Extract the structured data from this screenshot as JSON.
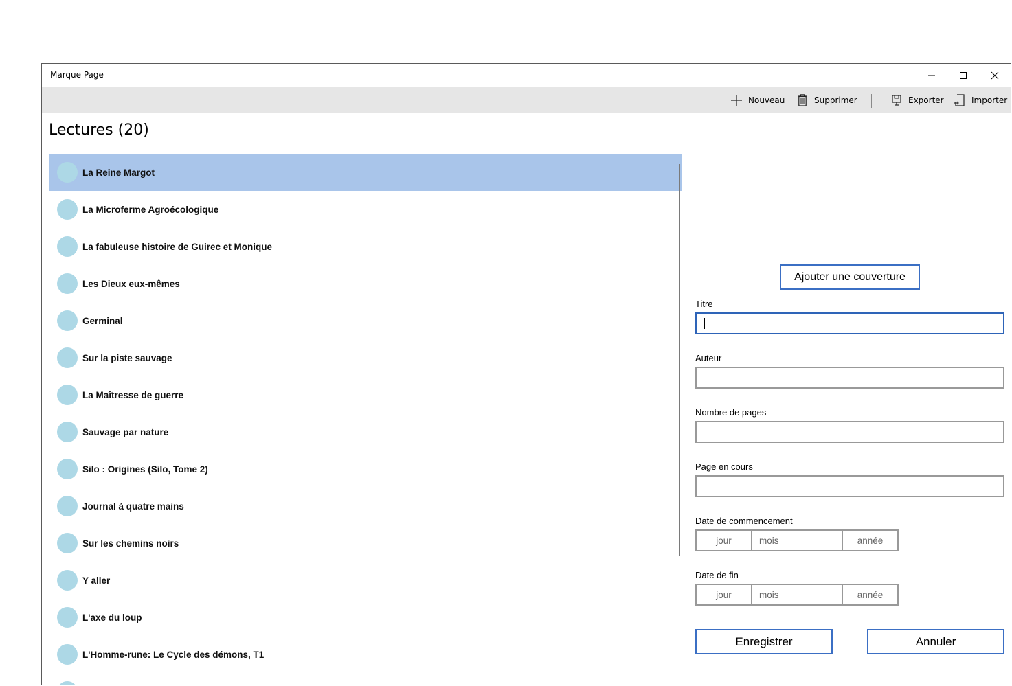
{
  "window": {
    "title": "Marque Page",
    "controls": {
      "minimize_icon": "minimize-icon",
      "maximize_icon": "maximize-icon",
      "close_icon": "close-icon"
    }
  },
  "commandbar": {
    "nouveau": "Nouveau",
    "supprimer": "Supprimer",
    "exporter": "Exporter",
    "importer": "Importer"
  },
  "list": {
    "title": "Lectures (20)",
    "selected_index": 0,
    "items": [
      {
        "label": "La Reine Margot"
      },
      {
        "label": "La Microferme Agroécologique"
      },
      {
        "label": "La fabuleuse histoire de Guirec et Monique"
      },
      {
        "label": "Les Dieux eux-mêmes"
      },
      {
        "label": "Germinal"
      },
      {
        "label": "Sur la piste sauvage"
      },
      {
        "label": "La Maîtresse de guerre"
      },
      {
        "label": "Sauvage par nature"
      },
      {
        "label": "Silo : Origines (Silo, Tome 2)"
      },
      {
        "label": "Journal à quatre mains"
      },
      {
        "label": "Sur les chemins noirs"
      },
      {
        "label": "Y aller"
      },
      {
        "label": "L'axe du loup"
      },
      {
        "label": "L'Homme-rune: Le Cycle des démons, T1"
      },
      {
        "label": ""
      }
    ]
  },
  "form": {
    "cover_button": "Ajouter une couverture",
    "titre_label": "Titre",
    "titre_value": "",
    "auteur_label": "Auteur",
    "auteur_value": "",
    "pages_label": "Nombre de pages",
    "pages_value": "",
    "page_en_cours_label": "Page en cours",
    "page_en_cours_value": "",
    "date_debut_label": "Date de commencement",
    "date_fin_label": "Date de fin",
    "date_placeholders": {
      "jour": "jour",
      "mois": "mois",
      "annee": "année"
    },
    "save_button": "Enregistrer",
    "cancel_button": "Annuler"
  },
  "colors": {
    "selected_row": "#a9c5ea",
    "avatar": "#add8e6",
    "accent_border": "#3b6fc4",
    "commandbar_bg": "#e6e6e6"
  }
}
